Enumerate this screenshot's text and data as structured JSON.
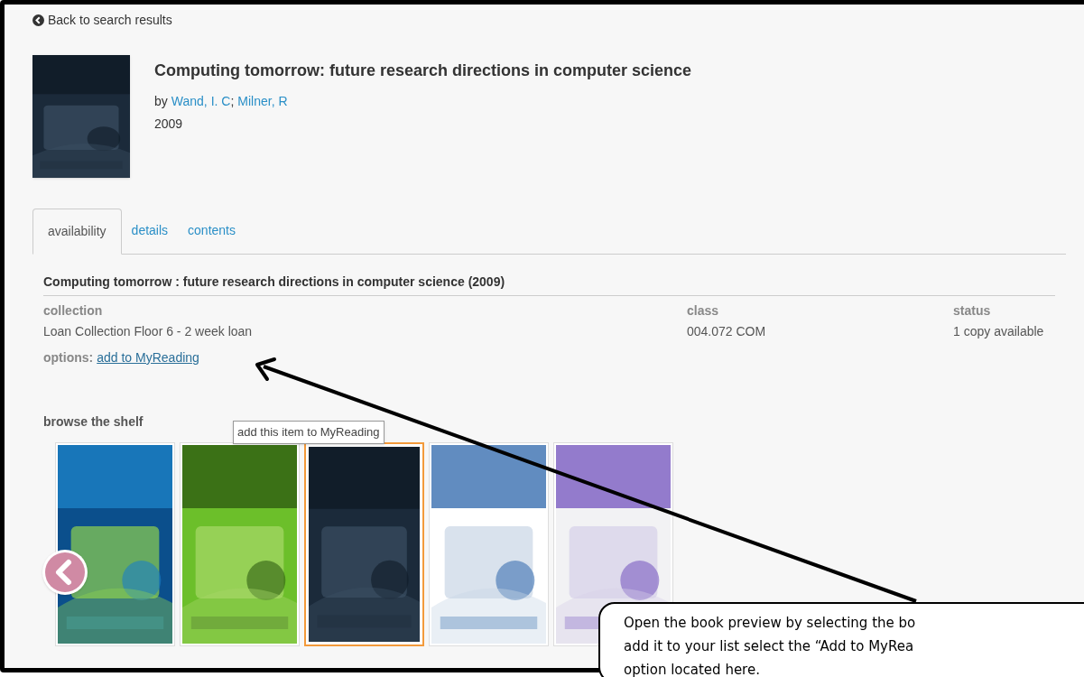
{
  "back_link": {
    "label": "Back to search results"
  },
  "record": {
    "title": "Computing tomorrow: future research directions in computer science",
    "by": "by",
    "authors": [
      "Wand, I. C",
      "Milner, R"
    ],
    "author_separator": ";",
    "year": "2009"
  },
  "tabs": [
    {
      "label": "availability",
      "selected": true
    },
    {
      "label": "details",
      "selected": false
    },
    {
      "label": "contents",
      "selected": false
    }
  ],
  "holdings": {
    "heading": "Computing tomorrow : future research directions in computer science (2009)",
    "columns": [
      {
        "label": "collection",
        "value": "Loan Collection Floor 6 - 2 week loan"
      },
      {
        "label": "class",
        "value": "004.072 COM"
      },
      {
        "label": "status",
        "value": "1 copy available"
      }
    ],
    "options_label": "options:",
    "option_link": "add to MyReading"
  },
  "tooltip": "add this item to MyReading",
  "shelf": {
    "heading": "browse the shelf",
    "covers": [
      {
        "kind": "picture",
        "selected": false
      },
      {
        "kind": "picture",
        "selected": false
      },
      {
        "kind": "picture",
        "selected": true
      },
      {
        "kind": "picture",
        "selected": false
      },
      {
        "kind": "picture",
        "selected": false
      }
    ]
  },
  "callout": {
    "lines": [
      "Open the book preview by selecting the bo",
      "add it to your list select the “Add to MyRea",
      "option located here."
    ]
  }
}
